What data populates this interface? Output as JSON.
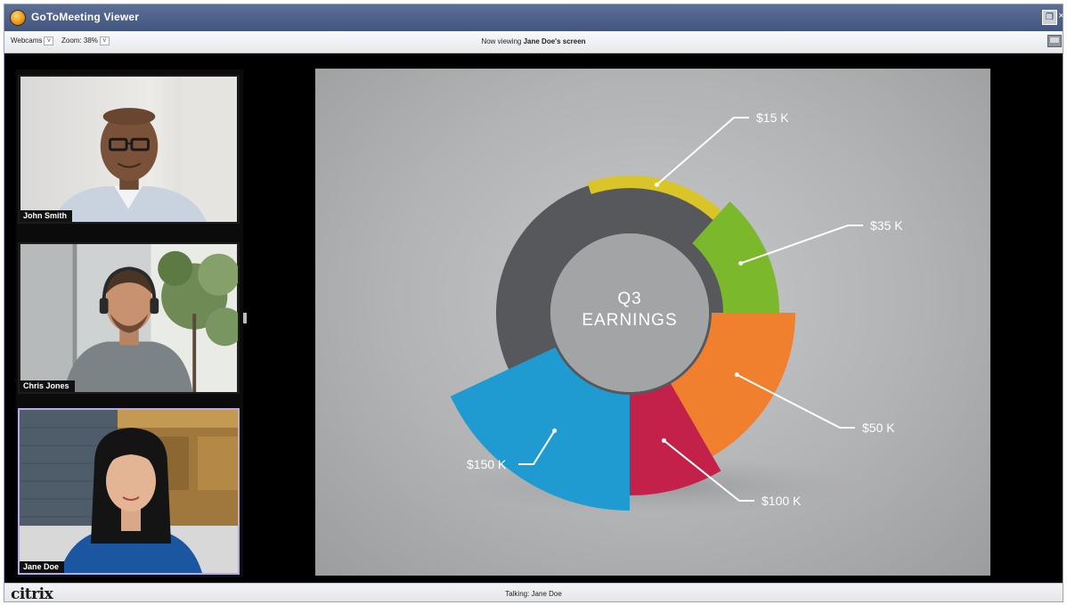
{
  "window": {
    "title": "GoToMeeting Viewer",
    "icon": "gotomeeting-flower-icon"
  },
  "toolbar": {
    "webcams_label": "Webcams",
    "zoom_label": "Zoom: 38%",
    "viewing_prefix": "Now viewing",
    "viewing_name": "Jane Doe's screen"
  },
  "webcams": [
    {
      "name": "John Smith",
      "active": false
    },
    {
      "name": "Chris Jones",
      "active": false
    },
    {
      "name": "Jane Doe",
      "active": true
    }
  ],
  "slide": {
    "center_line1": "Q3",
    "center_line2": "EARNINGS",
    "colors": {
      "ring": "#57585b",
      "hole": "#a3a4a6",
      "yellow": "#d9c52a",
      "green": "#7cb82b",
      "orange": "#f07f2e",
      "red": "#c4214a",
      "blue": "#1f9bd1"
    }
  },
  "chart_data": {
    "type": "pie",
    "title": "Q3 EARNINGS",
    "categories": [
      "$15 K",
      "$35 K",
      "$50 K",
      "$100 K",
      "$150 K"
    ],
    "values": [
      15,
      35,
      50,
      100,
      150
    ],
    "colors": [
      "#d9c52a",
      "#7cb82b",
      "#f07f2e",
      "#c4214a",
      "#1f9bd1"
    ]
  },
  "statusbar": {
    "logo": "citrix",
    "talking": "Talking: Jane Doe"
  }
}
